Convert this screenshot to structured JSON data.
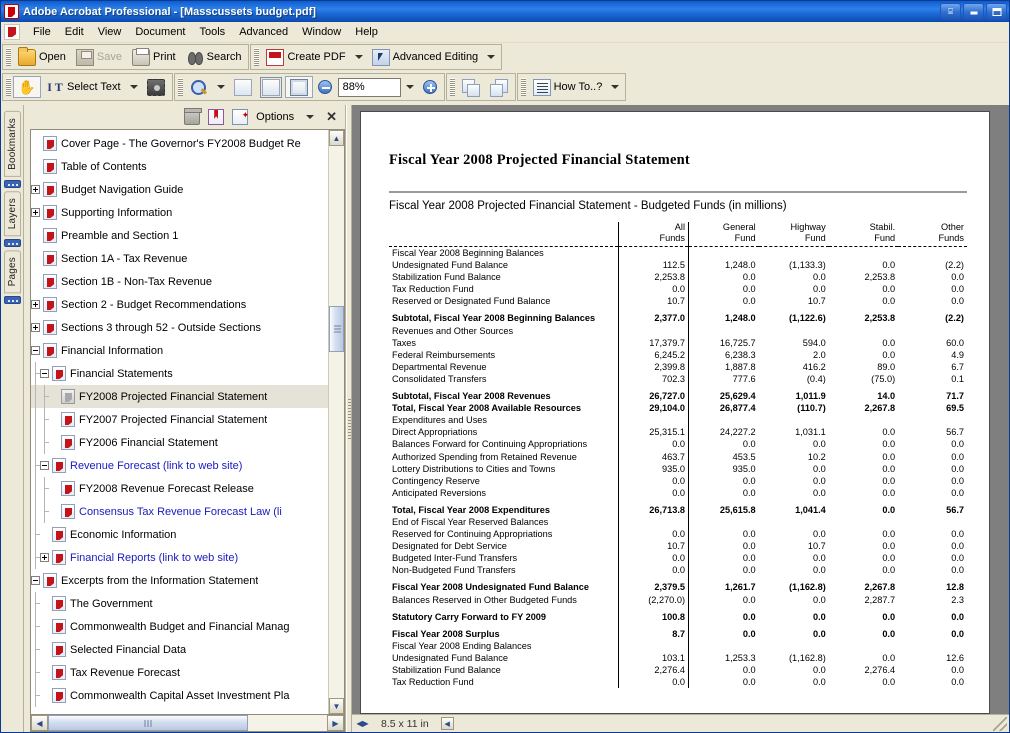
{
  "window": {
    "title": "Adobe Acrobat Professional - [Masscussets budget.pdf]",
    "app_icon": "acrobat-icon",
    "minimize_label": "",
    "maximize_label": "",
    "close_label": "✕",
    "pin_label": ""
  },
  "menubar": {
    "items": [
      "File",
      "Edit",
      "View",
      "Document",
      "Tools",
      "Advanced",
      "Window",
      "Help"
    ]
  },
  "toolbar_main": {
    "buttons": [
      {
        "label": "Open",
        "icon": "open-folder-icon",
        "disabled": false
      },
      {
        "label": "Save",
        "icon": "save-disk-icon",
        "disabled": true
      },
      {
        "label": "Print",
        "icon": "printer-icon",
        "disabled": false
      },
      {
        "label": "Search",
        "icon": "binoculars-icon",
        "disabled": false
      }
    ],
    "create_pdf_label": "Create PDF",
    "create_pdf_icon": "create-pdf-icon",
    "advanced_editing_label": "Advanced Editing",
    "advanced_editing_icon": "advanced-editing-icon"
  },
  "toolbar_secondary": {
    "hand_icon": "hand-tool-icon",
    "select_text_label": "Select Text",
    "select_text_icon": "select-text-icon",
    "snapshot_icon": "snapshot-camera-icon",
    "zoom_tool_icon": "zoom-in-tool-icon",
    "fit_page_icon": "fit-page-icon",
    "fit_width_icon": "fit-width-icon",
    "fit_visible_icon": "fit-visible-icon",
    "zoom_out_icon": "zoom-out-icon",
    "zoom_value": "88%",
    "zoom_in_icon": "zoom-in-icon",
    "previous_view_icon": "previous-view-icon",
    "next_view_icon": "next-view-icon",
    "how_to_label": "How To..?",
    "how_to_icon": "how-to-icon"
  },
  "navpanel": {
    "vertical_tabs": [
      "Bookmarks",
      "Layers",
      "Pages"
    ],
    "active_tab": "Bookmarks",
    "header": {
      "delete_icon": "trash-icon",
      "expand_icon": "bookmark-panel-icon",
      "new_bookmark_icon": "new-bookmark-icon",
      "options_label": "Options",
      "close_label": "✕"
    },
    "bookmarks": [
      {
        "label": "Cover Page - The Governor's FY2008 Budget Re",
        "depth": 0,
        "expander": "none",
        "link": false,
        "selected": false,
        "icon": "pdf-bookmark-icon"
      },
      {
        "label": "Table of Contents",
        "depth": 0,
        "expander": "none",
        "link": false,
        "selected": false,
        "icon": "pdf-bookmark-icon"
      },
      {
        "label": "Budget Navigation Guide",
        "depth": 0,
        "expander": "plus",
        "link": false,
        "selected": false,
        "icon": "pdf-bookmark-icon"
      },
      {
        "label": "Supporting Information",
        "depth": 0,
        "expander": "plus",
        "link": false,
        "selected": false,
        "icon": "pdf-bookmark-icon"
      },
      {
        "label": "Preamble and Section 1",
        "depth": 0,
        "expander": "none",
        "link": false,
        "selected": false,
        "icon": "pdf-bookmark-icon"
      },
      {
        "label": "Section 1A - Tax Revenue",
        "depth": 0,
        "expander": "none",
        "link": false,
        "selected": false,
        "icon": "pdf-bookmark-icon"
      },
      {
        "label": "Section 1B - Non-Tax Revenue",
        "depth": 0,
        "expander": "none",
        "link": false,
        "selected": false,
        "icon": "pdf-bookmark-icon"
      },
      {
        "label": "Section 2 - Budget Recommendations",
        "depth": 0,
        "expander": "plus",
        "link": false,
        "selected": false,
        "icon": "pdf-bookmark-icon"
      },
      {
        "label": "Sections 3 through 52 - Outside Sections",
        "depth": 0,
        "expander": "plus",
        "link": false,
        "selected": false,
        "icon": "pdf-bookmark-icon"
      },
      {
        "label": "Financial Information",
        "depth": 0,
        "expander": "minus",
        "link": false,
        "selected": false,
        "icon": "pdf-bookmark-icon"
      },
      {
        "label": "Financial Statements",
        "depth": 1,
        "expander": "minus",
        "link": false,
        "selected": false,
        "icon": "pdf-bookmark-icon"
      },
      {
        "label": "FY2008 Projected Financial Statement",
        "depth": 2,
        "expander": "none",
        "link": false,
        "selected": true,
        "icon": "current-bookmark-icon"
      },
      {
        "label": "FY2007 Projected Financial Statement",
        "depth": 2,
        "expander": "none",
        "link": false,
        "selected": false,
        "icon": "pdf-bookmark-icon"
      },
      {
        "label": "FY2006 Financial Statement",
        "depth": 2,
        "expander": "none",
        "link": false,
        "selected": false,
        "icon": "pdf-bookmark-icon"
      },
      {
        "label": "Revenue Forecast (link to web site)",
        "depth": 1,
        "expander": "minus",
        "link": true,
        "selected": false,
        "icon": "pdf-bookmark-icon"
      },
      {
        "label": "FY2008 Revenue Forecast Release",
        "depth": 2,
        "expander": "none",
        "link": false,
        "selected": false,
        "icon": "pdf-bookmark-icon"
      },
      {
        "label": "Consensus Tax Revenue Forecast Law (li",
        "depth": 2,
        "expander": "none",
        "link": true,
        "selected": false,
        "icon": "pdf-bookmark-icon"
      },
      {
        "label": "Economic Information",
        "depth": 1,
        "expander": "none",
        "link": false,
        "selected": false,
        "icon": "pdf-bookmark-icon"
      },
      {
        "label": "Financial Reports (link to web site)",
        "depth": 1,
        "expander": "plus",
        "link": true,
        "selected": false,
        "icon": "pdf-bookmark-icon"
      },
      {
        "label": "Excerpts from the Information Statement",
        "depth": 0,
        "expander": "minus",
        "link": false,
        "selected": false,
        "icon": "pdf-bookmark-icon"
      },
      {
        "label": "The Government",
        "depth": 1,
        "expander": "none",
        "link": false,
        "selected": false,
        "icon": "pdf-bookmark-icon"
      },
      {
        "label": "Commonwealth Budget and Financial Manag",
        "depth": 1,
        "expander": "none",
        "link": false,
        "selected": false,
        "icon": "pdf-bookmark-icon"
      },
      {
        "label": "Selected Financial Data",
        "depth": 1,
        "expander": "none",
        "link": false,
        "selected": false,
        "icon": "pdf-bookmark-icon"
      },
      {
        "label": "Tax Revenue Forecast",
        "depth": 1,
        "expander": "none",
        "link": false,
        "selected": false,
        "icon": "pdf-bookmark-icon"
      },
      {
        "label": "Commonwealth Capital Asset Investment Pla",
        "depth": 1,
        "expander": "none",
        "link": false,
        "selected": false,
        "icon": "pdf-bookmark-icon"
      }
    ]
  },
  "document": {
    "title": "Fiscal Year 2008 Projected Financial Statement",
    "subtitle": "Fiscal Year 2008 Projected Financial Statement - Budgeted Funds (in millions)",
    "columns": [
      {
        "line1": "All",
        "line2": "Funds"
      },
      {
        "line1": "General",
        "line2": "Fund"
      },
      {
        "line1": "Highway",
        "line2": "Fund"
      },
      {
        "line1": "Stabil.",
        "line2": "Fund"
      },
      {
        "line1": "Other",
        "line2": "Funds"
      }
    ],
    "rows": [
      {
        "label": "Fiscal Year 2008 Beginning Balances",
        "values": [
          "",
          "",
          "",
          "",
          ""
        ],
        "bold": false,
        "dashed_top": true
      },
      {
        "label": "Undesignated Fund Balance",
        "values": [
          "112.5",
          "1,248.0",
          "(1,133.3)",
          "0.0",
          "(2.2)"
        ],
        "bold": false
      },
      {
        "label": "Stabilization Fund Balance",
        "values": [
          "2,253.8",
          "0.0",
          "0.0",
          "2,253.8",
          "0.0"
        ],
        "bold": false
      },
      {
        "label": "Tax Reduction Fund",
        "values": [
          "0.0",
          "0.0",
          "0.0",
          "0.0",
          "0.0"
        ],
        "bold": false
      },
      {
        "label": "Reserved or Designated Fund Balance",
        "values": [
          "10.7",
          "0.0",
          "10.7",
          "0.0",
          "0.0"
        ],
        "bold": false
      },
      {
        "label": "",
        "values": [
          "",
          "",
          "",
          "",
          ""
        ],
        "bold": false,
        "gap": true
      },
      {
        "label": "Subtotal, Fiscal Year 2008 Beginning Balances",
        "values": [
          "2,377.0",
          "1,248.0",
          "(1,122.6)",
          "2,253.8",
          "(2.2)"
        ],
        "bold": true
      },
      {
        "label": "Revenues and Other Sources",
        "values": [
          "",
          "",
          "",
          "",
          ""
        ],
        "bold": false
      },
      {
        "label": "Taxes",
        "values": [
          "17,379.7",
          "16,725.7",
          "594.0",
          "0.0",
          "60.0"
        ],
        "bold": false
      },
      {
        "label": "Federal Reimbursements",
        "values": [
          "6,245.2",
          "6,238.3",
          "2.0",
          "0.0",
          "4.9"
        ],
        "bold": false
      },
      {
        "label": "Departmental Revenue",
        "values": [
          "2,399.8",
          "1,887.8",
          "416.2",
          "89.0",
          "6.7"
        ],
        "bold": false
      },
      {
        "label": "Consolidated Transfers",
        "values": [
          "702.3",
          "777.6",
          "(0.4)",
          "(75.0)",
          "0.1"
        ],
        "bold": false
      },
      {
        "label": "",
        "values": [
          "",
          "",
          "",
          "",
          ""
        ],
        "bold": false,
        "gap": true
      },
      {
        "label": "Subtotal, Fiscal Year 2008 Revenues",
        "values": [
          "26,727.0",
          "25,629.4",
          "1,011.9",
          "14.0",
          "71.7"
        ],
        "bold": true
      },
      {
        "label": "Total, Fiscal Year 2008 Available Resources",
        "values": [
          "29,104.0",
          "26,877.4",
          "(110.7)",
          "2,267.8",
          "69.5"
        ],
        "bold": true
      },
      {
        "label": "Expenditures and Uses",
        "values": [
          "",
          "",
          "",
          "",
          ""
        ],
        "bold": false
      },
      {
        "label": "Direct Appropriations",
        "values": [
          "25,315.1",
          "24,227.2",
          "1,031.1",
          "0.0",
          "56.7"
        ],
        "bold": false
      },
      {
        "label": "Balances Forward for Continuing Appropriations",
        "values": [
          "0.0",
          "0.0",
          "0.0",
          "0.0",
          "0.0"
        ],
        "bold": false
      },
      {
        "label": "Authorized Spending from Retained Revenue",
        "values": [
          "463.7",
          "453.5",
          "10.2",
          "0.0",
          "0.0"
        ],
        "bold": false
      },
      {
        "label": "Lottery Distributions to Cities and Towns",
        "values": [
          "935.0",
          "935.0",
          "0.0",
          "0.0",
          "0.0"
        ],
        "bold": false
      },
      {
        "label": "Contingency Reserve",
        "values": [
          "0.0",
          "0.0",
          "0.0",
          "0.0",
          "0.0"
        ],
        "bold": false
      },
      {
        "label": "Anticipated Reversions",
        "values": [
          "0.0",
          "0.0",
          "0.0",
          "0.0",
          "0.0"
        ],
        "bold": false
      },
      {
        "label": "",
        "values": [
          "",
          "",
          "",
          "",
          ""
        ],
        "bold": false,
        "gap": true
      },
      {
        "label": "Total, Fiscal Year 2008 Expenditures",
        "values": [
          "26,713.8",
          "25,615.8",
          "1,041.4",
          "0.0",
          "56.7"
        ],
        "bold": true
      },
      {
        "label": "End of Fiscal Year Reserved Balances",
        "values": [
          "",
          "",
          "",
          "",
          ""
        ],
        "bold": false
      },
      {
        "label": "Reserved for Continuing Appropriations",
        "values": [
          "0.0",
          "0.0",
          "0.0",
          "0.0",
          "0.0"
        ],
        "bold": false
      },
      {
        "label": "Designated for Debt Service",
        "values": [
          "10.7",
          "0.0",
          "10.7",
          "0.0",
          "0.0"
        ],
        "bold": false
      },
      {
        "label": "Budgeted Inter-Fund Transfers",
        "values": [
          "0.0",
          "0.0",
          "0.0",
          "0.0",
          "0.0"
        ],
        "bold": false
      },
      {
        "label": "Non-Budgeted Fund Transfers",
        "values": [
          "0.0",
          "0.0",
          "0.0",
          "0.0",
          "0.0"
        ],
        "bold": false
      },
      {
        "label": "",
        "values": [
          "",
          "",
          "",
          "",
          ""
        ],
        "bold": false,
        "gap": true
      },
      {
        "label": "Fiscal Year 2008 Undesignated Fund Balance",
        "values": [
          "2,379.5",
          "1,261.7",
          "(1,162.8)",
          "2,267.8",
          "12.8"
        ],
        "bold": true
      },
      {
        "label": "Balances Reserved in Other Budgeted Funds",
        "values": [
          "(2,270.0)",
          "0.0",
          "0.0",
          "2,287.7",
          "2.3"
        ],
        "bold": false
      },
      {
        "label": "",
        "values": [
          "",
          "",
          "",
          "",
          ""
        ],
        "bold": false,
        "gap": true
      },
      {
        "label": "Statutory Carry Forward to FY 2009",
        "values": [
          "100.8",
          "0.0",
          "0.0",
          "0.0",
          "0.0"
        ],
        "bold": true
      },
      {
        "label": "",
        "values": [
          "",
          "",
          "",
          "",
          ""
        ],
        "bold": false,
        "gap": true
      },
      {
        "label": "Fiscal Year 2008 Surplus",
        "values": [
          "8.7",
          "0.0",
          "0.0",
          "0.0",
          "0.0"
        ],
        "bold": true
      },
      {
        "label": "Fiscal Year 2008 Ending Balances",
        "values": [
          "",
          "",
          "",
          "",
          ""
        ],
        "bold": false
      },
      {
        "label": "Undesignated Fund Balance",
        "values": [
          "103.1",
          "1,253.3",
          "(1,162.8)",
          "0.0",
          "12.6"
        ],
        "bold": false
      },
      {
        "label": "Stabilization Fund Balance",
        "values": [
          "2,276.4",
          "0.0",
          "0.0",
          "2,276.4",
          "0.0"
        ],
        "bold": false
      },
      {
        "label": "Tax Reduction Fund",
        "values": [
          "0.0",
          "0.0",
          "0.0",
          "0.0",
          "0.0"
        ],
        "bold": false
      }
    ]
  },
  "statusbar": {
    "page_size": "8.5 x 11 in"
  },
  "colors": {
    "titlebar_blue": "#1464d6",
    "chrome": "#ece9d8",
    "link_blue": "#1a1ac0",
    "selection": "#e5e3d7",
    "page_background": "#7f7f7f"
  }
}
